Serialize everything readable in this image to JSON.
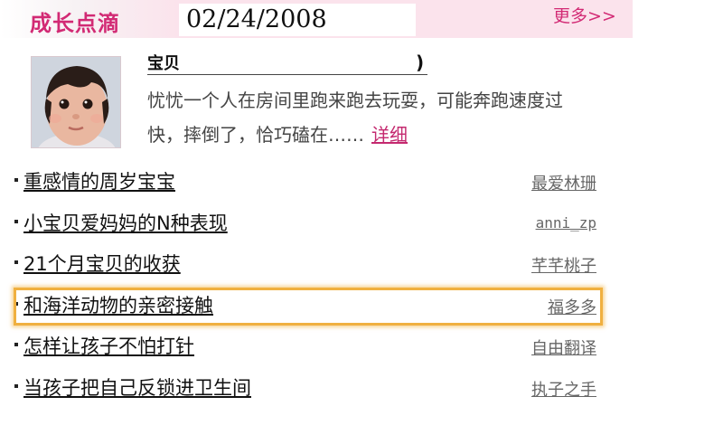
{
  "header": {
    "title": "成长点滴",
    "date": "02/24/2008",
    "more_label": "更多>>"
  },
  "featured": {
    "name": "宝贝",
    "name_suffix": ")",
    "summary": "忧忧一个人在房间里跑来跑去玩耍，可能奔跑速度过快，摔倒了，恰巧磕在……",
    "detail_label": "详细"
  },
  "articles": [
    {
      "title": "重感情的周岁宝宝",
      "author": "最爱林珊"
    },
    {
      "title": "小宝贝爱妈妈的N种表现",
      "author": "anni_zp"
    },
    {
      "title": "21个月宝贝的收获",
      "author": "芊芊桃子"
    },
    {
      "title": "和海洋动物的亲密接触",
      "author": "福多多"
    },
    {
      "title": "怎样让孩子不怕打针",
      "author": "自由翻译"
    },
    {
      "title": "当孩子把自己反锁进卫生间",
      "author": "执子之手"
    }
  ],
  "colors": {
    "accent": "#d22a74",
    "highlight": "#f0b040"
  }
}
